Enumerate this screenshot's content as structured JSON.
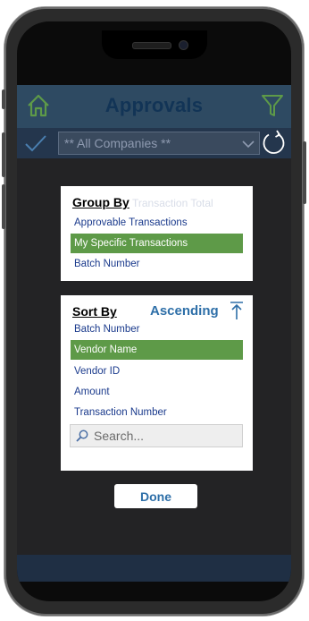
{
  "header": {
    "title": "Approvals",
    "icons": {
      "left": "home-icon",
      "right": "filter-icon"
    }
  },
  "toolbar": {
    "company_select": "** All Companies **",
    "icons": [
      "check-icon",
      "chevron-down-icon",
      "refresh-icon"
    ]
  },
  "group_by": {
    "heading": "Group By",
    "ghost_text": "Transaction Total",
    "options": [
      {
        "label": "Approvable Transactions",
        "selected": false
      },
      {
        "label": "My Specific Transactions",
        "selected": true
      },
      {
        "label": "Batch Number",
        "selected": false
      }
    ]
  },
  "sort_by": {
    "heading": "Sort By",
    "direction": "Ascending",
    "options": [
      {
        "label": "Batch Number",
        "selected": false
      },
      {
        "label": "Vendor Name",
        "selected": true
      },
      {
        "label": "Vendor ID",
        "selected": false
      },
      {
        "label": "Amount",
        "selected": false
      },
      {
        "label": "Transaction Number",
        "selected": false
      }
    ],
    "search_placeholder": "Search..."
  },
  "done_label": "Done",
  "colors": {
    "header_bg": "#2e4a62",
    "title": "#123456",
    "accent_green": "#5e9a48",
    "link_blue": "#1a3a8c",
    "sort_blue": "#2e6fa8"
  }
}
